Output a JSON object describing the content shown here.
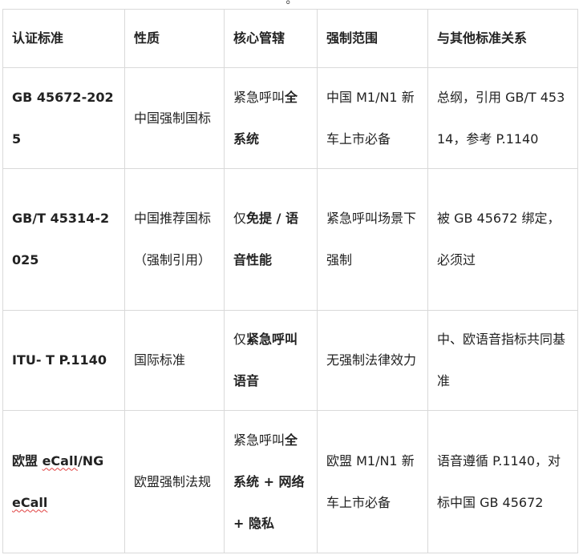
{
  "top_fragment": "。",
  "headers": [
    "认证标准",
    "性质",
    "核心管辖",
    "强制范围",
    "与其他标准关系"
  ],
  "rows": [
    {
      "standard": "GB 45672-2025",
      "nature": "中国强制国标",
      "scope_pre": "紧急呼叫",
      "scope_bold": "全系统",
      "scope_post": "",
      "mandatory": "中国 M1/N1 新车上市必备",
      "relation": "总纲，引用 GB/T 45314，参考 P.1140"
    },
    {
      "standard": "GB/T 45314-2025",
      "nature": "中国推荐国标（强制引用）",
      "scope_pre": "仅",
      "scope_bold": "免提 / 语音性能",
      "scope_post": "",
      "mandatory": "紧急呼叫场景下强制",
      "relation": "被 GB 45672 绑定，必须过"
    },
    {
      "standard": "ITU- T P.1140",
      "nature": "国际标准",
      "scope_pre": "仅",
      "scope_bold": "紧急呼叫语音",
      "scope_post": "",
      "mandatory": "无强制法律效力",
      "relation": "中、欧语音指标共同基准"
    },
    {
      "standard_part1": "欧盟 ",
      "standard_part2": "eCall",
      "standard_part3": "/NG ",
      "standard_part4": "eCall",
      "nature": "欧盟强制法规",
      "scope_pre": "紧急呼叫",
      "scope_bold": "全系统 + 网络 + 隐私",
      "scope_post": "",
      "mandatory": "欧盟 M1/N1 新车上市必备",
      "relation": "语音遵循 P.1140，对标中国 GB 45672"
    }
  ]
}
